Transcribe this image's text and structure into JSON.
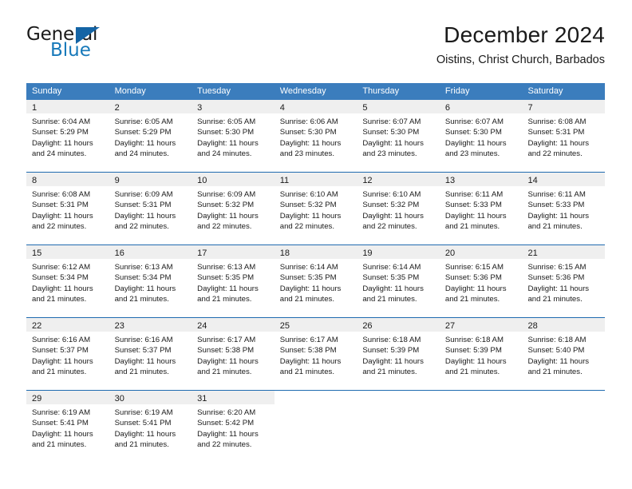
{
  "brand": {
    "word_one": "General",
    "word_two": "Blue",
    "triangle_icon": "triangle-icon",
    "colors": {
      "blue": "#1779ba",
      "triangle": "#1464a5",
      "dark": "#1a1a1a"
    }
  },
  "header": {
    "title": "December 2024",
    "subtitle": "Oistins, Christ Church, Barbados"
  },
  "calendar": {
    "accent_header_bg": "#3b7dbd",
    "week_divider": "#1f6bb0",
    "daynum_band_bg": "#efefef",
    "weekdays": [
      "Sunday",
      "Monday",
      "Tuesday",
      "Wednesday",
      "Thursday",
      "Friday",
      "Saturday"
    ],
    "weeks": [
      [
        {
          "day": "1",
          "sunrise": "Sunrise: 6:04 AM",
          "sunset": "Sunset: 5:29 PM",
          "daylight": "Daylight: 11 hours and 24 minutes."
        },
        {
          "day": "2",
          "sunrise": "Sunrise: 6:05 AM",
          "sunset": "Sunset: 5:29 PM",
          "daylight": "Daylight: 11 hours and 24 minutes."
        },
        {
          "day": "3",
          "sunrise": "Sunrise: 6:05 AM",
          "sunset": "Sunset: 5:30 PM",
          "daylight": "Daylight: 11 hours and 24 minutes."
        },
        {
          "day": "4",
          "sunrise": "Sunrise: 6:06 AM",
          "sunset": "Sunset: 5:30 PM",
          "daylight": "Daylight: 11 hours and 23 minutes."
        },
        {
          "day": "5",
          "sunrise": "Sunrise: 6:07 AM",
          "sunset": "Sunset: 5:30 PM",
          "daylight": "Daylight: 11 hours and 23 minutes."
        },
        {
          "day": "6",
          "sunrise": "Sunrise: 6:07 AM",
          "sunset": "Sunset: 5:30 PM",
          "daylight": "Daylight: 11 hours and 23 minutes."
        },
        {
          "day": "7",
          "sunrise": "Sunrise: 6:08 AM",
          "sunset": "Sunset: 5:31 PM",
          "daylight": "Daylight: 11 hours and 22 minutes."
        }
      ],
      [
        {
          "day": "8",
          "sunrise": "Sunrise: 6:08 AM",
          "sunset": "Sunset: 5:31 PM",
          "daylight": "Daylight: 11 hours and 22 minutes."
        },
        {
          "day": "9",
          "sunrise": "Sunrise: 6:09 AM",
          "sunset": "Sunset: 5:31 PM",
          "daylight": "Daylight: 11 hours and 22 minutes."
        },
        {
          "day": "10",
          "sunrise": "Sunrise: 6:09 AM",
          "sunset": "Sunset: 5:32 PM",
          "daylight": "Daylight: 11 hours and 22 minutes."
        },
        {
          "day": "11",
          "sunrise": "Sunrise: 6:10 AM",
          "sunset": "Sunset: 5:32 PM",
          "daylight": "Daylight: 11 hours and 22 minutes."
        },
        {
          "day": "12",
          "sunrise": "Sunrise: 6:10 AM",
          "sunset": "Sunset: 5:32 PM",
          "daylight": "Daylight: 11 hours and 22 minutes."
        },
        {
          "day": "13",
          "sunrise": "Sunrise: 6:11 AM",
          "sunset": "Sunset: 5:33 PM",
          "daylight": "Daylight: 11 hours and 21 minutes."
        },
        {
          "day": "14",
          "sunrise": "Sunrise: 6:11 AM",
          "sunset": "Sunset: 5:33 PM",
          "daylight": "Daylight: 11 hours and 21 minutes."
        }
      ],
      [
        {
          "day": "15",
          "sunrise": "Sunrise: 6:12 AM",
          "sunset": "Sunset: 5:34 PM",
          "daylight": "Daylight: 11 hours and 21 minutes."
        },
        {
          "day": "16",
          "sunrise": "Sunrise: 6:13 AM",
          "sunset": "Sunset: 5:34 PM",
          "daylight": "Daylight: 11 hours and 21 minutes."
        },
        {
          "day": "17",
          "sunrise": "Sunrise: 6:13 AM",
          "sunset": "Sunset: 5:35 PM",
          "daylight": "Daylight: 11 hours and 21 minutes."
        },
        {
          "day": "18",
          "sunrise": "Sunrise: 6:14 AM",
          "sunset": "Sunset: 5:35 PM",
          "daylight": "Daylight: 11 hours and 21 minutes."
        },
        {
          "day": "19",
          "sunrise": "Sunrise: 6:14 AM",
          "sunset": "Sunset: 5:35 PM",
          "daylight": "Daylight: 11 hours and 21 minutes."
        },
        {
          "day": "20",
          "sunrise": "Sunrise: 6:15 AM",
          "sunset": "Sunset: 5:36 PM",
          "daylight": "Daylight: 11 hours and 21 minutes."
        },
        {
          "day": "21",
          "sunrise": "Sunrise: 6:15 AM",
          "sunset": "Sunset: 5:36 PM",
          "daylight": "Daylight: 11 hours and 21 minutes."
        }
      ],
      [
        {
          "day": "22",
          "sunrise": "Sunrise: 6:16 AM",
          "sunset": "Sunset: 5:37 PM",
          "daylight": "Daylight: 11 hours and 21 minutes."
        },
        {
          "day": "23",
          "sunrise": "Sunrise: 6:16 AM",
          "sunset": "Sunset: 5:37 PM",
          "daylight": "Daylight: 11 hours and 21 minutes."
        },
        {
          "day": "24",
          "sunrise": "Sunrise: 6:17 AM",
          "sunset": "Sunset: 5:38 PM",
          "daylight": "Daylight: 11 hours and 21 minutes."
        },
        {
          "day": "25",
          "sunrise": "Sunrise: 6:17 AM",
          "sunset": "Sunset: 5:38 PM",
          "daylight": "Daylight: 11 hours and 21 minutes."
        },
        {
          "day": "26",
          "sunrise": "Sunrise: 6:18 AM",
          "sunset": "Sunset: 5:39 PM",
          "daylight": "Daylight: 11 hours and 21 minutes."
        },
        {
          "day": "27",
          "sunrise": "Sunrise: 6:18 AM",
          "sunset": "Sunset: 5:39 PM",
          "daylight": "Daylight: 11 hours and 21 minutes."
        },
        {
          "day": "28",
          "sunrise": "Sunrise: 6:18 AM",
          "sunset": "Sunset: 5:40 PM",
          "daylight": "Daylight: 11 hours and 21 minutes."
        }
      ],
      [
        {
          "day": "29",
          "sunrise": "Sunrise: 6:19 AM",
          "sunset": "Sunset: 5:41 PM",
          "daylight": "Daylight: 11 hours and 21 minutes."
        },
        {
          "day": "30",
          "sunrise": "Sunrise: 6:19 AM",
          "sunset": "Sunset: 5:41 PM",
          "daylight": "Daylight: 11 hours and 21 minutes."
        },
        {
          "day": "31",
          "sunrise": "Sunrise: 6:20 AM",
          "sunset": "Sunset: 5:42 PM",
          "daylight": "Daylight: 11 hours and 22 minutes."
        },
        {
          "day": "",
          "sunrise": "",
          "sunset": "",
          "daylight": ""
        },
        {
          "day": "",
          "sunrise": "",
          "sunset": "",
          "daylight": ""
        },
        {
          "day": "",
          "sunrise": "",
          "sunset": "",
          "daylight": ""
        },
        {
          "day": "",
          "sunrise": "",
          "sunset": "",
          "daylight": ""
        }
      ]
    ]
  }
}
